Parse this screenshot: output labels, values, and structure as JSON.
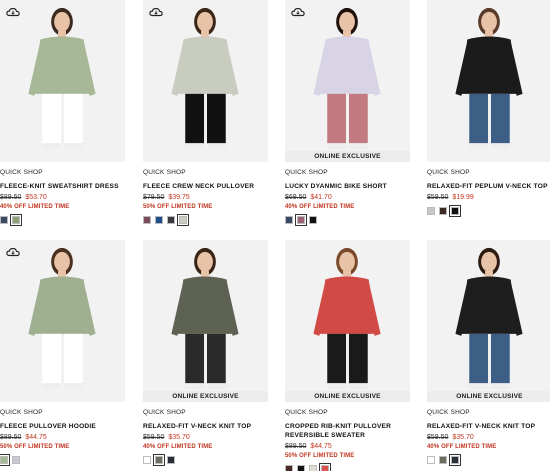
{
  "quick_shop_label": "QUICK SHOP",
  "products": [
    {
      "name": "FLEECE-KNIT SWEATSHIRT DRESS",
      "orig_price": "$89.50",
      "sale_price": "$53.70",
      "promo": "40% OFF LIMITED TIME",
      "badge": "",
      "cloud_icon": "cloud-icon",
      "swatches": [
        "#3a4a63",
        "#8aa37a"
      ],
      "selected_swatch": 1,
      "garment_color": "#a6b896",
      "bottom_color": "#ffffff",
      "hair_color": "#3c2a1e"
    },
    {
      "name": "FLEECE CREW NECK PULLOVER",
      "orig_price": "$79.50",
      "sale_price": "$39.75",
      "promo": "50% OFF LIMITED TIME",
      "badge": "",
      "cloud_icon": "cloud-icon",
      "swatches": [
        "#7a4b5a",
        "#1f4f8a",
        "#3a3a40",
        "#c8cdc0"
      ],
      "selected_swatch": 3,
      "garment_color": "#c9cdbf",
      "bottom_color": "#111111",
      "hair_color": "#3b2618"
    },
    {
      "name": "LUCKY DYANMIC BIKE SHORT",
      "orig_price": "$69.50",
      "sale_price": "$41.70",
      "promo": "40% OFF LIMITED TIME",
      "badge": "ONLINE EXCLUSIVE",
      "cloud_icon": "cloud-icon",
      "swatches": [
        "#3a4a63",
        "#9b6274",
        "#111111"
      ],
      "selected_swatch": 1,
      "garment_color": "#d9d3e6",
      "bottom_color": "#c07a80",
      "hair_color": "#1e130c"
    },
    {
      "name": "RELAXED-FIT PEPLUM V-NECK TOP",
      "orig_price": "$59.50",
      "sale_price": "$19.99",
      "promo": "",
      "badge": "",
      "cloud_icon": "",
      "swatches": [
        "#c9c6c9",
        "#3b2a24",
        "#111111"
      ],
      "selected_swatch": 2,
      "garment_color": "#1b1b1b",
      "bottom_color": "#3d5f86",
      "hair_color": "#5a3a28"
    },
    {
      "name": "FLEECE PULLOVER HOODIE",
      "orig_price": "$89.50",
      "sale_price": "$44.75",
      "promo": "50% OFF LIMITED TIME",
      "badge": "",
      "cloud_icon": "cloud-icon",
      "swatches": [
        "#a7b894",
        "#c7c9d4"
      ],
      "selected_swatch": 0,
      "garment_color": "#9fb091",
      "bottom_color": "#ffffff",
      "hair_color": "#4a301f"
    },
    {
      "name": "RELAXED-FIT V-NECK KNIT TOP",
      "orig_price": "$59.50",
      "sale_price": "$35.70",
      "promo": "40% OFF LIMITED TIME",
      "badge": "ONLINE EXCLUSIVE",
      "cloud_icon": "",
      "swatches": [
        "#ffffff",
        "#6a6e5f",
        "#2a2e36"
      ],
      "selected_swatch": 1,
      "garment_color": "#5d6253",
      "bottom_color": "#2a2a2a",
      "hair_color": "#3a2416"
    },
    {
      "name": "CROPPED RIB-KNIT PULLOVER REVERSIBLE SWEATER",
      "orig_price": "$89.50",
      "sale_price": "$44.75",
      "promo": "50% OFF LIMITED TIME",
      "badge": "ONLINE EXCLUSIVE",
      "cloud_icon": "",
      "swatches": [
        "#4a2a26",
        "#111111",
        "#e0dcd2",
        "#d9534f"
      ],
      "selected_swatch": 3,
      "garment_color": "#d24a45",
      "bottom_color": "#1a1a1a",
      "hair_color": "#7a4a2a"
    },
    {
      "name": "RELAXED-FIT V-NECK KNIT TOP",
      "orig_price": "$59.50",
      "sale_price": "$35.70",
      "promo": "40% OFF LIMITED TIME",
      "badge": "ONLINE EXCLUSIVE",
      "cloud_icon": "",
      "swatches": [
        "#ffffff",
        "#6a6e5f",
        "#2a2e36"
      ],
      "selected_swatch": 2,
      "garment_color": "#1e1e1e",
      "bottom_color": "#3d5f86",
      "hair_color": "#2a1a10"
    }
  ]
}
